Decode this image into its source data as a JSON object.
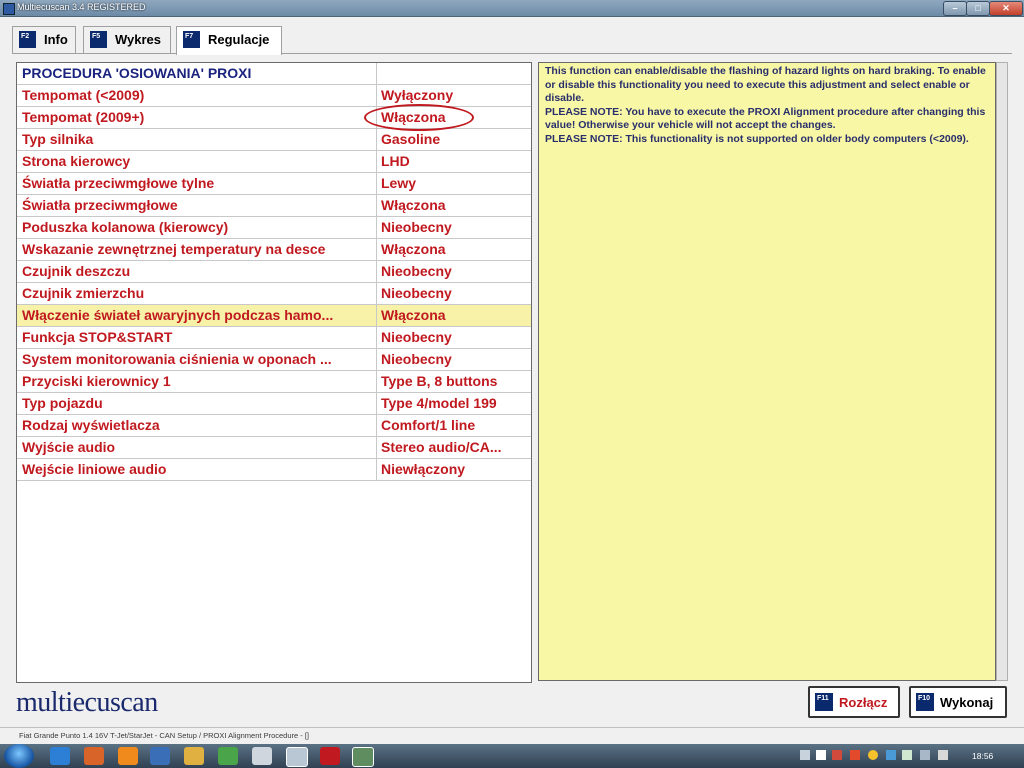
{
  "window": {
    "title": "Multiecuscan 3.4 REGISTERED",
    "minimize": "–",
    "maximize": "□",
    "close": "✕"
  },
  "tabs": [
    {
      "key": "F2",
      "label": "Info"
    },
    {
      "key": "F5",
      "label": "Wykres"
    },
    {
      "key": "F7",
      "label": "Regulacje"
    }
  ],
  "table": {
    "header": "PROCEDURA 'OSIOWANIA' PROXI",
    "rows": [
      {
        "name": "Tempomat (<2009)",
        "value": "Wyłączony"
      },
      {
        "name": "Tempomat (2009+)",
        "value": "Włączona"
      },
      {
        "name": "Typ silnika",
        "value": "Gasoline"
      },
      {
        "name": "Strona kierowcy",
        "value": "LHD"
      },
      {
        "name": "Światła przeciwmgłowe tylne",
        "value": "Lewy"
      },
      {
        "name": "Światła przeciwmgłowe",
        "value": "Włączona"
      },
      {
        "name": "Poduszka kolanowa (kierowcy)",
        "value": "Nieobecny"
      },
      {
        "name": "Wskazanie zewnętrznej temperatury na desce",
        "value": "Włączona"
      },
      {
        "name": "Czujnik deszczu",
        "value": "Nieobecny"
      },
      {
        "name": "Czujnik zmierzchu",
        "value": "Nieobecny"
      },
      {
        "name": "Włączenie świateł awaryjnych podczas hamo...",
        "value": "Włączona"
      },
      {
        "name": "Funkcja STOP&START",
        "value": "Nieobecny"
      },
      {
        "name": "System monitorowania ciśnienia w oponach ...",
        "value": "Nieobecny"
      },
      {
        "name": "Przyciski kierownicy 1",
        "value": "Type B, 8 buttons"
      },
      {
        "name": "Typ pojazdu",
        "value": "Type 4/model 199"
      },
      {
        "name": "Rodzaj wyświetlacza",
        "value": "Comfort/1 line"
      },
      {
        "name": "Wyjście audio",
        "value": "Stereo audio/CA..."
      },
      {
        "name": "Wejście liniowe audio",
        "value": "Niewłączony"
      }
    ]
  },
  "description": {
    "lines": [
      "This function can enable/disable the flashing of hazard lights on hard braking. To enable or disable this functionality you need to execute this adjustment and select enable or disable.",
      "PLEASE NOTE: You have to execute the PROXI Alignment procedure after changing this value! Otherwise your vehicle will not accept the changes.",
      "PLEASE NOTE: This functionality is not supported on older body computers (<2009)."
    ]
  },
  "logo": "multiecuscan",
  "buttons": {
    "disconnect": {
      "key": "F11",
      "label": "Rozłącz"
    },
    "execute": {
      "key": "F10",
      "label": "Wykonaj"
    }
  },
  "status": "Fiat Grande Punto 1.4 16V T-Jet/StarJet - CAN Setup / PROXI Alignment Procedure - []",
  "taskbar": {
    "time": "18:56"
  },
  "colors": {
    "value_text": "#c0191f",
    "header_text": "#1a237e",
    "selected_row": "#f7f2a8",
    "description_bg": "#f7f7a6"
  }
}
